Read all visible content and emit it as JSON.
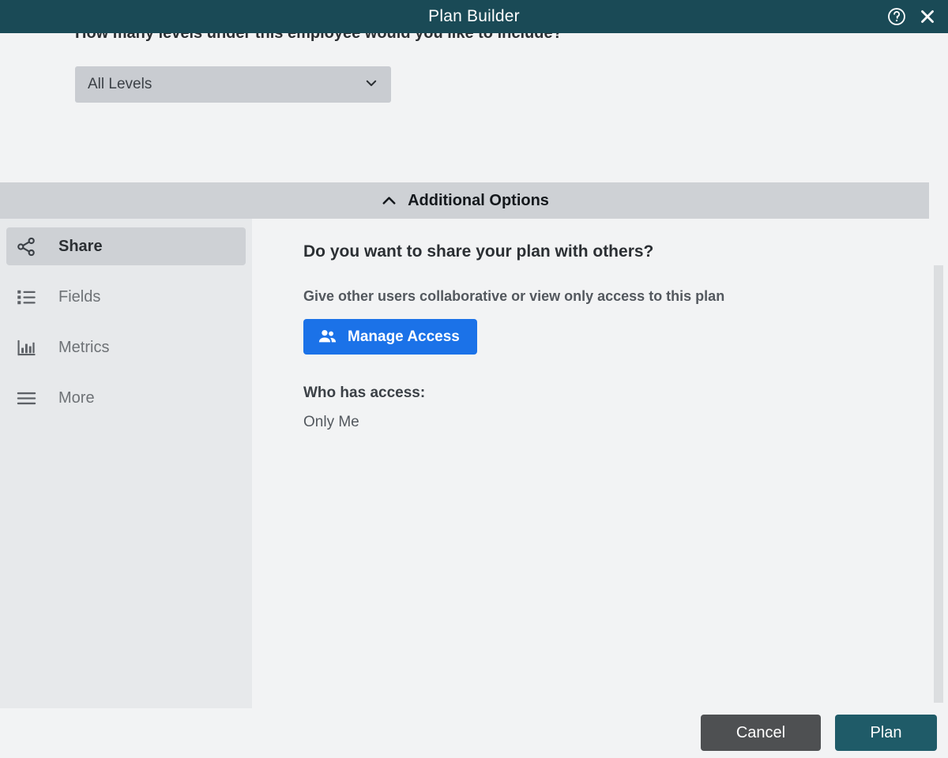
{
  "titlebar": {
    "title": "Plan Builder",
    "help_icon": "question-circle-icon",
    "close_icon": "close-icon"
  },
  "upper": {
    "question": "How many levels under this employee would you like to include?",
    "levels_select": {
      "value": "All Levels",
      "chevron_icon": "chevron-down-icon"
    }
  },
  "additional_options": {
    "label": "Additional Options",
    "chevron_icon": "chevron-up-icon",
    "expanded": true
  },
  "sidebar": {
    "items": [
      {
        "label": "Share",
        "icon": "share-nodes-icon",
        "active": true
      },
      {
        "label": "Fields",
        "icon": "list-icon",
        "active": false
      },
      {
        "label": "Metrics",
        "icon": "bar-chart-icon",
        "active": false
      },
      {
        "label": "More",
        "icon": "hamburger-icon",
        "active": false
      }
    ]
  },
  "main": {
    "heading": "Do you want to share your plan with others?",
    "subheading": "Give other users collaborative or view only access to this plan",
    "manage_access_button": {
      "label": "Manage Access",
      "icon": "users-icon"
    },
    "access_title": "Who has access:",
    "access_value": "Only Me"
  },
  "footer": {
    "cancel_label": "Cancel",
    "plan_label": "Plan"
  },
  "colors": {
    "titlebar": "#1a4a56",
    "accent_blue": "#1b72e8",
    "plan_button": "#1f5b68",
    "cancel_button": "#4e5052",
    "panel_bg": "#f2f3f4",
    "sidebar_bg": "#e7e9eb",
    "header_bar": "#ced1d5"
  }
}
